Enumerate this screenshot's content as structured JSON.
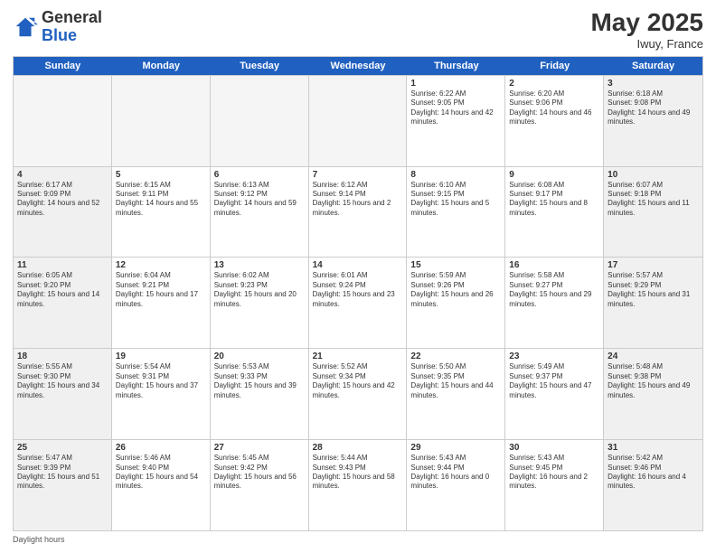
{
  "header": {
    "logo_general": "General",
    "logo_blue": "Blue",
    "month_year": "May 2025",
    "location": "Iwuy, France"
  },
  "weekdays": [
    "Sunday",
    "Monday",
    "Tuesday",
    "Wednesday",
    "Thursday",
    "Friday",
    "Saturday"
  ],
  "footer_text": "Daylight hours",
  "weeks": [
    [
      {
        "day": "",
        "text": "",
        "empty": true
      },
      {
        "day": "",
        "text": "",
        "empty": true
      },
      {
        "day": "",
        "text": "",
        "empty": true
      },
      {
        "day": "",
        "text": "",
        "empty": true
      },
      {
        "day": "1",
        "text": "Sunrise: 6:22 AM\nSunset: 9:05 PM\nDaylight: 14 hours and 42 minutes."
      },
      {
        "day": "2",
        "text": "Sunrise: 6:20 AM\nSunset: 9:06 PM\nDaylight: 14 hours and 46 minutes."
      },
      {
        "day": "3",
        "text": "Sunrise: 6:18 AM\nSunset: 9:08 PM\nDaylight: 14 hours and 49 minutes."
      }
    ],
    [
      {
        "day": "4",
        "text": "Sunrise: 6:17 AM\nSunset: 9:09 PM\nDaylight: 14 hours and 52 minutes."
      },
      {
        "day": "5",
        "text": "Sunrise: 6:15 AM\nSunset: 9:11 PM\nDaylight: 14 hours and 55 minutes."
      },
      {
        "day": "6",
        "text": "Sunrise: 6:13 AM\nSunset: 9:12 PM\nDaylight: 14 hours and 59 minutes."
      },
      {
        "day": "7",
        "text": "Sunrise: 6:12 AM\nSunset: 9:14 PM\nDaylight: 15 hours and 2 minutes."
      },
      {
        "day": "8",
        "text": "Sunrise: 6:10 AM\nSunset: 9:15 PM\nDaylight: 15 hours and 5 minutes."
      },
      {
        "day": "9",
        "text": "Sunrise: 6:08 AM\nSunset: 9:17 PM\nDaylight: 15 hours and 8 minutes."
      },
      {
        "day": "10",
        "text": "Sunrise: 6:07 AM\nSunset: 9:18 PM\nDaylight: 15 hours and 11 minutes."
      }
    ],
    [
      {
        "day": "11",
        "text": "Sunrise: 6:05 AM\nSunset: 9:20 PM\nDaylight: 15 hours and 14 minutes."
      },
      {
        "day": "12",
        "text": "Sunrise: 6:04 AM\nSunset: 9:21 PM\nDaylight: 15 hours and 17 minutes."
      },
      {
        "day": "13",
        "text": "Sunrise: 6:02 AM\nSunset: 9:23 PM\nDaylight: 15 hours and 20 minutes."
      },
      {
        "day": "14",
        "text": "Sunrise: 6:01 AM\nSunset: 9:24 PM\nDaylight: 15 hours and 23 minutes."
      },
      {
        "day": "15",
        "text": "Sunrise: 5:59 AM\nSunset: 9:26 PM\nDaylight: 15 hours and 26 minutes."
      },
      {
        "day": "16",
        "text": "Sunrise: 5:58 AM\nSunset: 9:27 PM\nDaylight: 15 hours and 29 minutes."
      },
      {
        "day": "17",
        "text": "Sunrise: 5:57 AM\nSunset: 9:29 PM\nDaylight: 15 hours and 31 minutes."
      }
    ],
    [
      {
        "day": "18",
        "text": "Sunrise: 5:55 AM\nSunset: 9:30 PM\nDaylight: 15 hours and 34 minutes."
      },
      {
        "day": "19",
        "text": "Sunrise: 5:54 AM\nSunset: 9:31 PM\nDaylight: 15 hours and 37 minutes."
      },
      {
        "day": "20",
        "text": "Sunrise: 5:53 AM\nSunset: 9:33 PM\nDaylight: 15 hours and 39 minutes."
      },
      {
        "day": "21",
        "text": "Sunrise: 5:52 AM\nSunset: 9:34 PM\nDaylight: 15 hours and 42 minutes."
      },
      {
        "day": "22",
        "text": "Sunrise: 5:50 AM\nSunset: 9:35 PM\nDaylight: 15 hours and 44 minutes."
      },
      {
        "day": "23",
        "text": "Sunrise: 5:49 AM\nSunset: 9:37 PM\nDaylight: 15 hours and 47 minutes."
      },
      {
        "day": "24",
        "text": "Sunrise: 5:48 AM\nSunset: 9:38 PM\nDaylight: 15 hours and 49 minutes."
      }
    ],
    [
      {
        "day": "25",
        "text": "Sunrise: 5:47 AM\nSunset: 9:39 PM\nDaylight: 15 hours and 51 minutes."
      },
      {
        "day": "26",
        "text": "Sunrise: 5:46 AM\nSunset: 9:40 PM\nDaylight: 15 hours and 54 minutes."
      },
      {
        "day": "27",
        "text": "Sunrise: 5:45 AM\nSunset: 9:42 PM\nDaylight: 15 hours and 56 minutes."
      },
      {
        "day": "28",
        "text": "Sunrise: 5:44 AM\nSunset: 9:43 PM\nDaylight: 15 hours and 58 minutes."
      },
      {
        "day": "29",
        "text": "Sunrise: 5:43 AM\nSunset: 9:44 PM\nDaylight: 16 hours and 0 minutes."
      },
      {
        "day": "30",
        "text": "Sunrise: 5:43 AM\nSunset: 9:45 PM\nDaylight: 16 hours and 2 minutes."
      },
      {
        "day": "31",
        "text": "Sunrise: 5:42 AM\nSunset: 9:46 PM\nDaylight: 16 hours and 4 minutes."
      }
    ]
  ]
}
